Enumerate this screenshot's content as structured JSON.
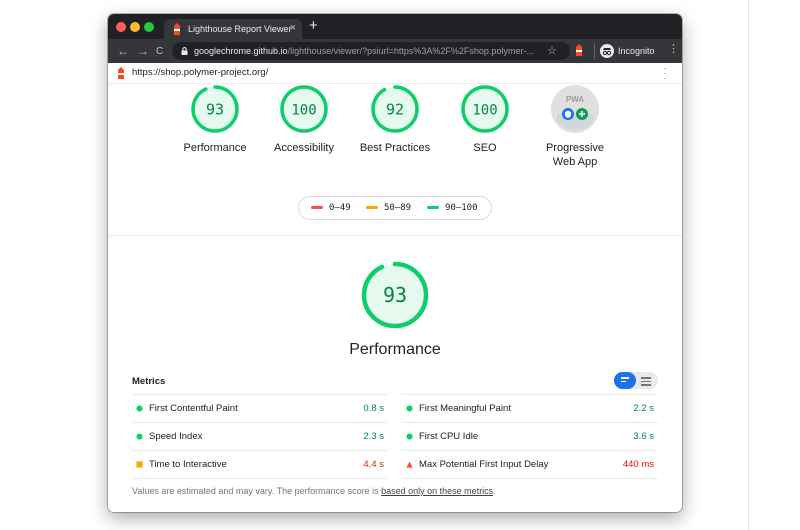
{
  "browser": {
    "tab_title": "Lighthouse Report Viewer",
    "close_glyph": "×",
    "new_tab_glyph": "+",
    "nav": {
      "back_glyph": "←",
      "forward_glyph": "→",
      "reload_glyph": "C"
    },
    "url_host": "googlechrome.github.io",
    "url_rest": "/lighthouse/viewer/?psiurl=https%3A%2F%2Fshop.polymer-...",
    "star_glyph": "☆",
    "incognito_label": "Incognito",
    "menu_glyph": "⋮"
  },
  "report": {
    "url": "https://shop.polymer-project.org/",
    "menu_glyph": "⋮"
  },
  "colors": {
    "pass": "#0cce6b",
    "average": "#ffa400",
    "fail": "#ff4e42",
    "pass_text": "#018642",
    "fail_text": "#eb0f00"
  },
  "categories": [
    {
      "score": "93",
      "label": "Performance"
    },
    {
      "score": "100",
      "label": "Accessibility"
    },
    {
      "score": "92",
      "label": "Best Practices"
    },
    {
      "score": "100",
      "label": "SEO"
    },
    {
      "label_line1": "Progressive",
      "label_line2": "Web App",
      "badge_text": "PWA"
    }
  ],
  "legend": [
    {
      "range": "0–49"
    },
    {
      "range": "50–89"
    },
    {
      "range": "90–100"
    }
  ],
  "performance": {
    "score": "93",
    "title": "Performance"
  },
  "metrics": {
    "title": "Metrics",
    "left": [
      {
        "name": "First Contentful Paint",
        "value": "0.8 s",
        "rating": "pass"
      },
      {
        "name": "Speed Index",
        "value": "2.3 s",
        "rating": "pass"
      },
      {
        "name": "Time to Interactive",
        "value": "4.4 s",
        "rating": "average"
      }
    ],
    "right": [
      {
        "name": "First Meaningful Paint",
        "value": "2.2 s",
        "rating": "pass"
      },
      {
        "name": "First CPU Idle",
        "value": "3.6 s",
        "rating": "pass"
      },
      {
        "name": "Max Potential First Input Delay",
        "value": "440 ms",
        "rating": "fail"
      }
    ]
  },
  "footnote": {
    "text": "Values are estimated and may vary. The performance score is ",
    "link": "based only on these metrics",
    "end": "."
  }
}
